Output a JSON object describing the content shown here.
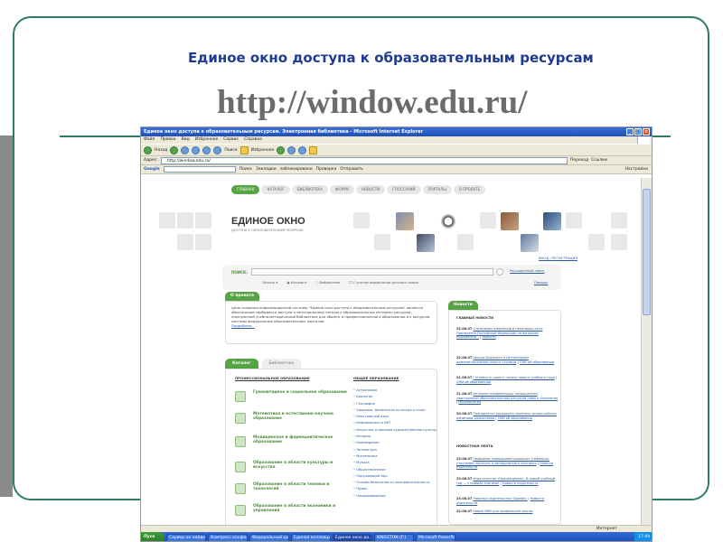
{
  "slide": {
    "title": "Единое окно доступа к образовательным ресурсам",
    "url": "http://window.edu.ru/"
  },
  "browser": {
    "window_title": "Единое окно доступа к образовательным ресурсам. Электронная библиотека - Microsoft Internet Explorer",
    "menu": [
      "Файл",
      "Правка",
      "Вид",
      "Избранное",
      "Сервис",
      "Справка"
    ],
    "toolbar": {
      "back": "Назад",
      "search": "Поиск",
      "favorites": "Избранное"
    },
    "address_label": "Адрес:",
    "address": "http://window.edu.ru/",
    "go_label": "Переход",
    "links_label": "Ссылки",
    "google_label": "Google",
    "google_items": [
      "Поиск",
      "Закладки",
      "заблокировано",
      "Проверка",
      "Отправить"
    ],
    "google_settings": "Настройки",
    "status_zone": "Интернет"
  },
  "site": {
    "nav": [
      "ГЛАВНАЯ",
      "КАТАЛОГ",
      "БИБЛИОТЕКА",
      "ФОРУМ",
      "НОВОСТИ",
      "ГЛОССАРИЙ",
      "ПОРТАЛЫ",
      "О ПРОЕКТЕ"
    ],
    "logo_title": "ЕДИНОЕ ОКНО",
    "logo_subtitle": "ДОСТУПА К ОБРАЗОВАТЕЛЬНЫМ РЕСУРСАМ",
    "login_links": "ВХОД / РЕГИСТРАЦИЯ",
    "search": {
      "label": "ПОИСК:",
      "advanced": "Расширенный поиск",
      "option1": "Искать в",
      "option2": "Каталоге",
      "option3": "Библиотеке",
      "option4": "С учетом морфологии русского языка",
      "help": "Помощь"
    },
    "about": {
      "heading": "О проекте",
      "text": "Цель создания информационной системы \"Единое окно доступа к образовательным ресурсам\" является обеспечение свободного доступа к интегральному каталогу образовательных интернет-ресурсов, электронной учебно-методической библиотеке для общего и профессионального образования и к ресурсам системы федеральных образовательных порталов.",
      "more": "Подробнее..."
    },
    "catalog": {
      "tab1": "Каталог",
      "tab2": "Библиотека",
      "col1_head": "ПРОФЕССИОНАЛЬНОЕ ОБРАЗОВАНИЕ",
      "col2_head": "ОБЩЕЕ ОБРАЗОВАНИЕ",
      "prof": [
        "Гуманитарное и социальное образование",
        "Математика и естественно-научное образование",
        "Медицинское и фармацевтическое образование",
        "Образование в области культуры и искусства",
        "Образование в области техники и технологий",
        "Образование в области экономики и управления"
      ],
      "subjects": [
        "Астрономия",
        "Биология",
        "География",
        "Здоровье, физическая культура и спорт",
        "Иностранный язык",
        "Информатика и ИКТ",
        "Искусство и мировая художественная культура",
        "История",
        "Краеведение",
        "Литература",
        "Математика",
        "Музыка",
        "Обществознание",
        "Окружающий мир",
        "Основы безопасности жизнедеятельности",
        "Право",
        "Природоведение"
      ]
    },
    "news": {
      "heading": "Новости",
      "main_title": "ГЛАВНЫЕ НОВОСТИ",
      "main": [
        {
          "date": "23.08.07",
          "text": "О внесении изменений в некоторые акты Президента Российской Федерации по вопросам присвоения...",
          "tag": "Новости"
        },
        {
          "date": "22.08.07",
          "text": "Школы будущего в Центральном административном округе столицы",
          "tag": "СМИ об образовании"
        },
        {
          "date": "21.08.07",
          "text": "Готовность школ к началу нового учебного года",
          "tag": "СМИ об образовании"
        },
        {
          "date": "21.08.07",
          "text": "Интернет-конференция, посвященная электронным образовательным ресурсам нового поколения",
          "tag": "Мероприятия"
        },
        {
          "date": "20.08.07",
          "text": "Планируется расширить перечень всероссийских олимпиад школьников",
          "tag": "СМИ об образовании"
        }
      ],
      "feed_title": "НОВОСТНАЯ ЛЕНТА",
      "feed": [
        {
          "date": "23.08.07",
          "text": "Проблемы содержания школьных учебников, уточнение научного и методического контроля",
          "tag": "Новости издательств"
        },
        {
          "date": "23.08.07",
          "text": "Издательство «Просвещение»: В новый учебный год — с новыми книгами!",
          "tag": "Новости издательств"
        },
        {
          "date": "23.08.07",
          "text": "Новинки издательства «Дрофа»",
          "tag": "Новости издательств"
        },
        {
          "date": "22.08.07",
          "text": "Новые УМК для профильной школы",
          "tag": ""
        }
      ]
    }
  },
  "taskbar": {
    "start": "Пуск",
    "tasks": [
      "Сервер не найде...",
      "Компресс конфер...",
      "Федеральный це...",
      "Единая коллекци...",
      "Единое окно до...",
      "KINGSTON (F:)",
      "Microsoft PowerPo..."
    ],
    "clock": "17:49"
  }
}
